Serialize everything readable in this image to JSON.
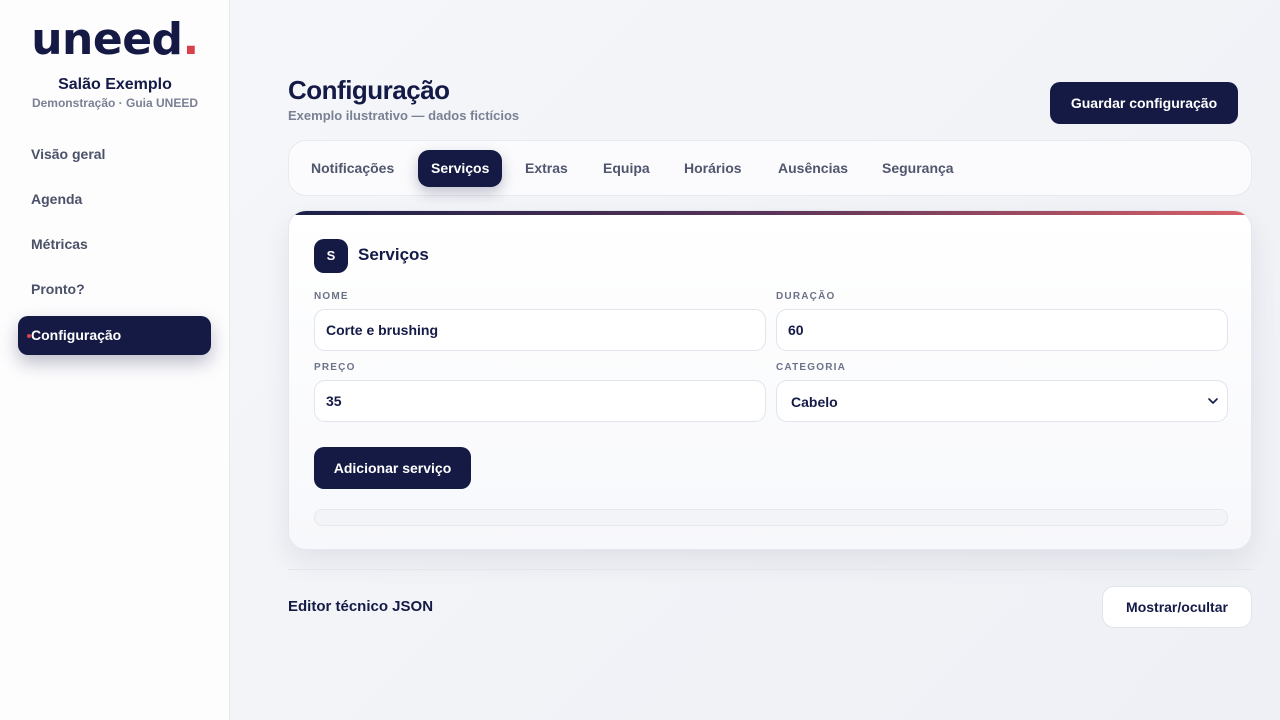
{
  "brand": {
    "logo_text": "uneed",
    "logo_dot": ".",
    "dot_color": "#d8404a",
    "primary_color": "#151a45"
  },
  "salon": {
    "name": "Salão Exemplo",
    "subtitle": "Demonstração · Guia UNEED"
  },
  "sidebar": {
    "items": [
      {
        "label": "Visão geral",
        "active": false
      },
      {
        "label": "Agenda",
        "active": false
      },
      {
        "label": "Métricas",
        "active": false
      },
      {
        "label": "Pronto?",
        "active": false
      },
      {
        "label": "Configuração",
        "active": true
      }
    ]
  },
  "header": {
    "title": "Configuração",
    "subtitle": "Exemplo ilustrativo — dados fictícios",
    "save_label": "Guardar configuração"
  },
  "tabs": [
    {
      "label": "Notificações",
      "active": false
    },
    {
      "label": "Serviços",
      "active": true
    },
    {
      "label": "Extras",
      "active": false
    },
    {
      "label": "Equipa",
      "active": false
    },
    {
      "label": "Horários",
      "active": false
    },
    {
      "label": "Ausências",
      "active": false
    },
    {
      "label": "Segurança",
      "active": false
    }
  ],
  "card": {
    "badge": "S",
    "title": "Serviços",
    "fields": {
      "name": {
        "label": "NOME",
        "value": "Corte e brushing"
      },
      "duration": {
        "label": "DURAÇÃO",
        "value": "60"
      },
      "price": {
        "label": "PREÇO",
        "value": "35"
      },
      "category": {
        "label": "CATEGORIA",
        "value": "Cabelo"
      }
    },
    "add_label": "Adicionar serviço"
  },
  "json_editor": {
    "label": "Editor técnico JSON",
    "toggle_label": "Mostrar/ocultar"
  }
}
